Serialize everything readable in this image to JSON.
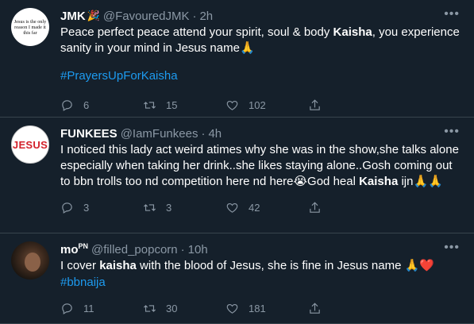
{
  "tweets": [
    {
      "name": "JMK",
      "name_emoji": "🎉",
      "handle": "@FavouredJMK",
      "time": "2h",
      "avatar_text": "Jesus is the only reason I made it this far",
      "text_parts": [
        "Peace perfect peace attend your spirit, soul & body ",
        "Kaisha",
        ", you experience sanity in your mind in Jesus name🙏"
      ],
      "hashtag": "#PrayersUpForKaisha",
      "replies": "6",
      "retweets": "15",
      "likes": "102"
    },
    {
      "name": "FUNKEES",
      "handle": "@IamFunkees",
      "time": "4h",
      "avatar_text": "JESUS",
      "text_parts": [
        "I noticed this lady act weird atimes why she was in the show,she talks alone especially when taking her drink..she likes staying alone..Gosh coming out to bbn trolls too nd competition here nd here😭God heal ",
        "Kaisha",
        " ijn🙏🙏"
      ],
      "replies": "3",
      "retweets": "3",
      "likes": "42"
    },
    {
      "name": "mo",
      "name_sup": "PN",
      "handle": "@filled_popcorn",
      "time": "10h",
      "text_parts": [
        "I cover ",
        "kaisha",
        " with the blood of Jesus, she is fine in Jesus name 🙏❤️"
      ],
      "hashtag": "#bbnaija",
      "replies": "11",
      "retweets": "30",
      "likes": "181"
    }
  ],
  "icons": {
    "more": "more-horizontal-icon",
    "reply": "reply-icon",
    "retweet": "retweet-icon",
    "like": "heart-icon",
    "share": "share-icon"
  },
  "colors": {
    "background": "#15202b",
    "divider": "#38444d",
    "text": "#ffffff",
    "muted": "#8b98a5",
    "link": "#1d9bf0"
  }
}
